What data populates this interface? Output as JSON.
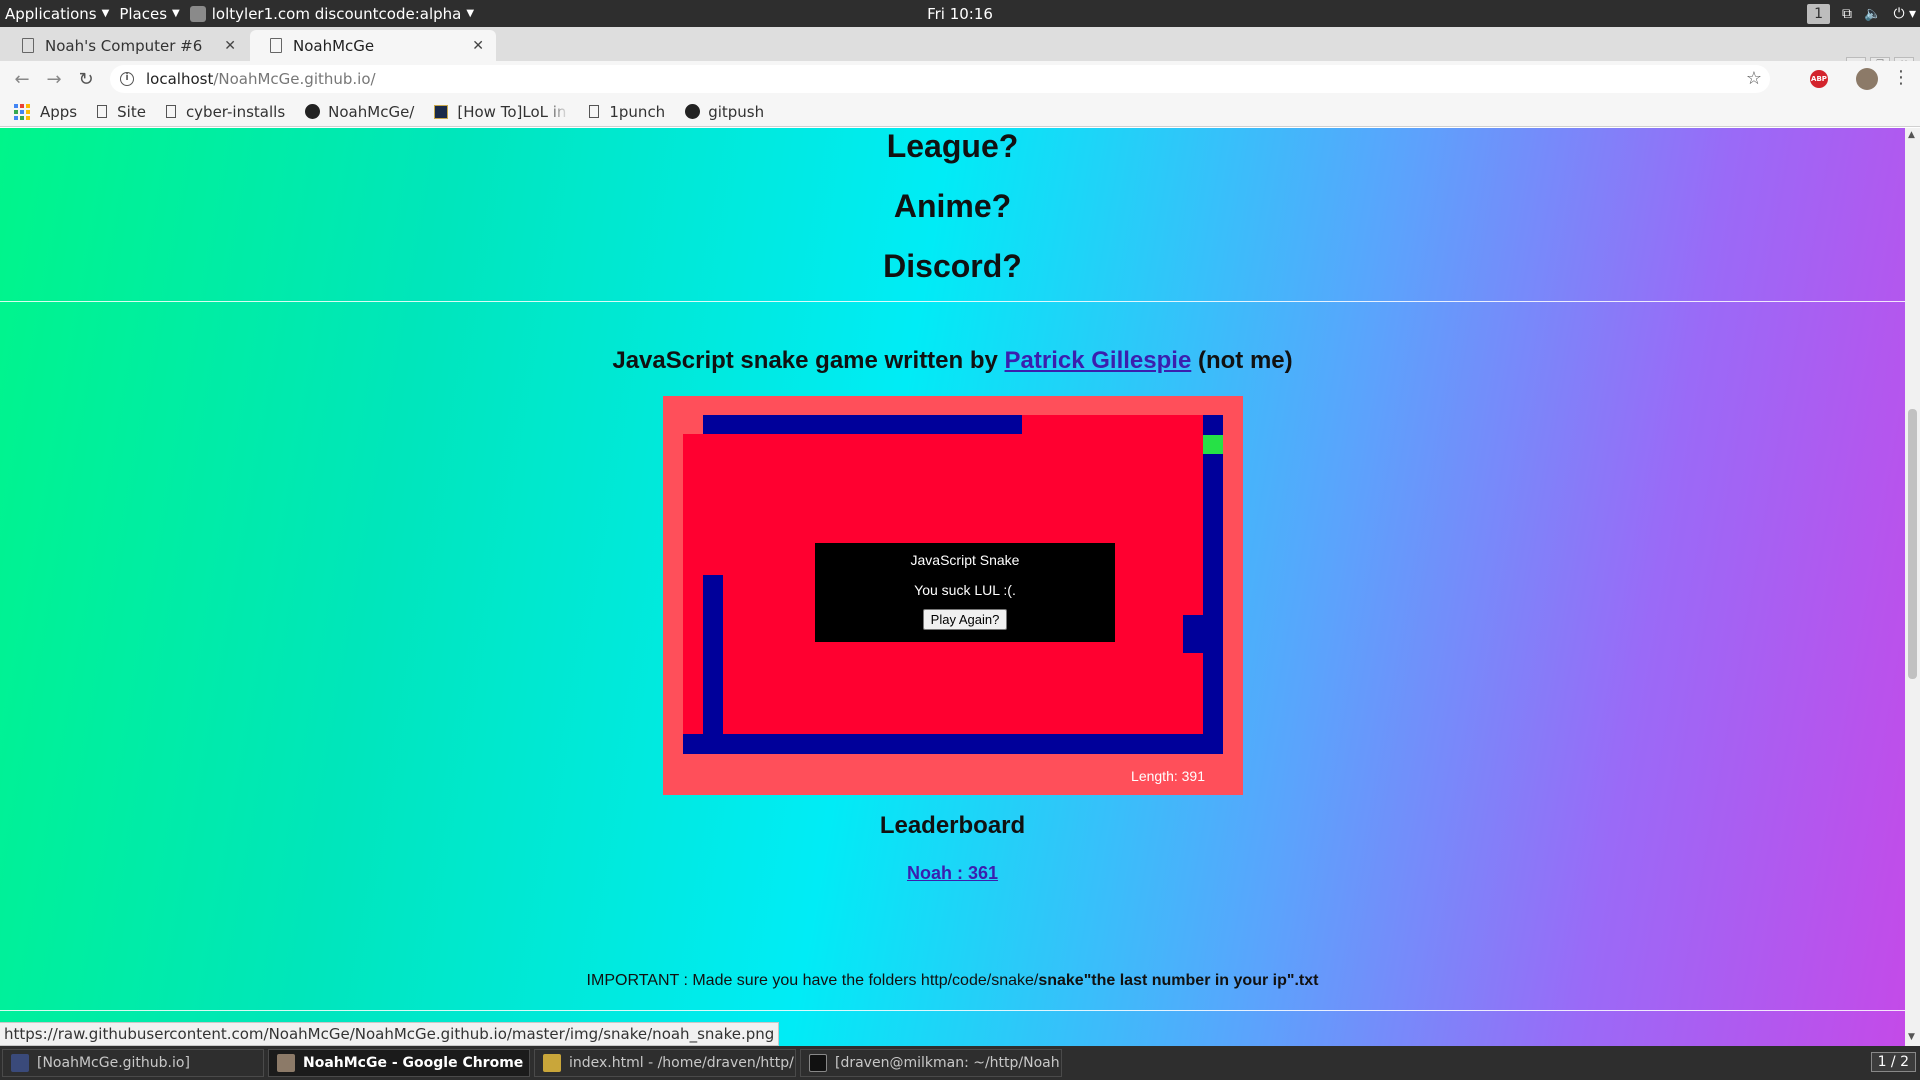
{
  "topbar": {
    "applications": "Applications",
    "places": "Places",
    "active_app": "loltyler1.com discountcode:alpha",
    "clock": "Fri 10:16",
    "workspace": "1"
  },
  "tabs": [
    {
      "title": "Noah's Computer #6"
    },
    {
      "title": "NoahMcGe"
    }
  ],
  "omnibox": {
    "host": "localhost",
    "path": "/NoahMcGe.github.io/"
  },
  "bookmarks": {
    "apps": "Apps",
    "site": "Site",
    "cyber": "cyber-installs",
    "noah": "NoahMcGe/",
    "lol": "[How To]LoL in a",
    "punch": "1punch",
    "gitpush": "gitpush"
  },
  "page": {
    "q1": "League?",
    "q2": "Anime?",
    "q3": "Discord?",
    "snake_title_pre": "JavaScript snake game written by ",
    "snake_author": "Patrick Gillespie",
    "snake_title_post": " (not me)",
    "dialog_title": "JavaScript Snake",
    "dialog_msg": "You suck LUL :(.",
    "play_again": "Play Again?",
    "length": "Length: 391",
    "leaderboard_title": "Leaderboard",
    "leader_entry": "Noah : 361",
    "important_pre": "IMPORTANT : Made sure you have the folders http/code/snake/",
    "important_bold": "snake\"the last number in your ip\".txt"
  },
  "status_url": "https://raw.githubusercontent.com/NoahMcGe/NoahMcGe.github.io/master/img/snake/noah_snake.png",
  "taskbar": [
    {
      "label": "[NoahMcGe.github.io]"
    },
    {
      "label": "NoahMcGe - Google Chrome"
    },
    {
      "label": "index.html - /home/draven/http/N..."
    },
    {
      "label": "[draven@milkman: ~/http/NoahM..."
    }
  ],
  "workspace_pager": "1 / 2",
  "colors": {
    "snake": "#00009a",
    "board": "#ff0030",
    "border": "#ff4f5a",
    "food": "#26e146"
  }
}
